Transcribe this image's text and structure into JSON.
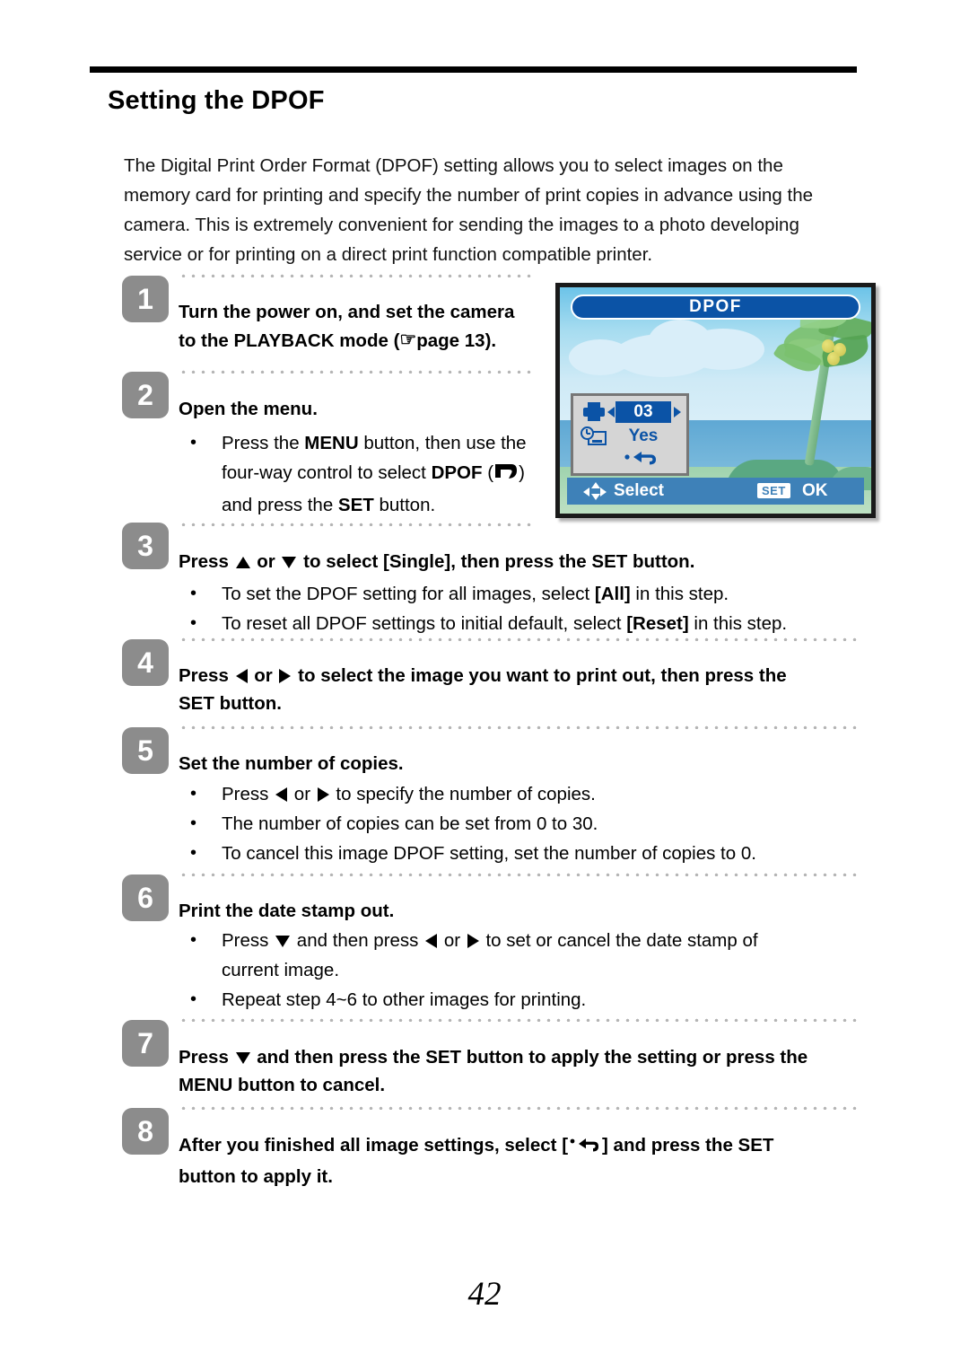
{
  "document": {
    "title": "Setting the DPOF",
    "page_number": "42",
    "intro": "The Digital Print Order Format (DPOF) setting allows you to select images on the memory card for printing and specify the number of print copies in advance using the camera. This is extremely convenient for sending the images to a photo developing service or for printing on a direct print function compatible printer."
  },
  "steps": [
    {
      "number": "1",
      "head_line1_a": "Turn the power on, and set the camera",
      "head_line2_a": "to the PLAYBACK mode (",
      "head_line2_b": "page 13).",
      "bullets": []
    },
    {
      "number": "2",
      "head_line1_a": "Open the menu.",
      "bullets": [
        {
          "dot": "•",
          "line1_a": "Press the ",
          "line1_b": "MENU",
          "line1_c": " button, then use the",
          "line2_a": "four-way control to select ",
          "line2_b": "DPOF",
          "line2_c": " (",
          "line2_d": ")",
          "line3_a": "and press the ",
          "line3_b": "SET",
          "line3_c": " button."
        }
      ]
    },
    {
      "number": "3",
      "head_a": "Press ",
      "head_b": " or ",
      "head_c": " to select [Single], then press the SET button.",
      "bullets": [
        {
          "dot": "•",
          "text_a": "To set the DPOF setting for all images, select ",
          "text_b": "[All]",
          "text_c": " in this step."
        },
        {
          "dot": "•",
          "text_a": "To reset all DPOF settings to initial default, select ",
          "text_b": "[Reset]",
          "text_c": " in this step."
        }
      ]
    },
    {
      "number": "4",
      "head_a": "Press ",
      "head_b": " or ",
      "head_c": " to select the image you want to print out, then press the",
      "head_line2": "SET button.",
      "bullets": []
    },
    {
      "number": "5",
      "head_a": "Set the number of copies.",
      "bullets": [
        {
          "dot": "•",
          "text_a": "Press ",
          "text_b": " or ",
          "text_c": " to specify the number of copies."
        },
        {
          "dot": "•",
          "text_a": "The number of copies can be set from 0 to 30."
        },
        {
          "dot": "•",
          "text_a": "To cancel this image DPOF setting, set the number of copies to 0."
        }
      ]
    },
    {
      "number": "6",
      "head_a": "Print the date stamp out.",
      "bullets": [
        {
          "dot": "•",
          "text_a": "Press ",
          "text_b": " and then press ",
          "text_c": " or ",
          "text_d": " to set or cancel the date stamp of",
          "text_e": "current image."
        },
        {
          "dot": "•",
          "text_a": "Repeat step 4~6 to other images for printing."
        }
      ]
    },
    {
      "number": "7",
      "head_a": "Press ",
      "head_b": " and then press the SET button to apply the setting or press the",
      "head_line2": "MENU button to cancel.",
      "bullets": []
    },
    {
      "number": "8",
      "head_a": "After you finished all image settings, select [",
      "head_b": "] and press the SET",
      "head_line2": "button to apply it.",
      "bullets": []
    }
  ],
  "lcd": {
    "title": "DPOF",
    "copies_value": "03",
    "date_stamp_value": "Yes",
    "return_glyph": "↰",
    "bottom_select_label": "Select",
    "bottom_set_badge": "SET",
    "bottom_ok_label": "OK",
    "colors": {
      "title_bar": "#0b53a6",
      "bottom_bar": "#3e81b8",
      "panel_bg": "#d5d5d5",
      "accent_blue": "#0b53a6"
    }
  }
}
